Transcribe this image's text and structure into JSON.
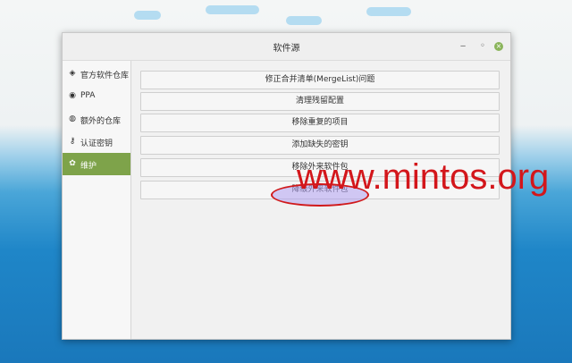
{
  "window": {
    "title": "软件源",
    "controls": {
      "minimize": "‒",
      "restore": "◦",
      "close": "×"
    }
  },
  "sidebar": {
    "items": [
      {
        "label": "官方软件仓库",
        "icon": "package-icon",
        "glyph": "◈"
      },
      {
        "label": "PPA",
        "icon": "ppa-icon",
        "glyph": "◉"
      },
      {
        "label": "额外的仓库",
        "icon": "repo-icon",
        "glyph": "◍"
      },
      {
        "label": "认证密钥",
        "icon": "key-icon",
        "glyph": "⚷"
      },
      {
        "label": "维护",
        "icon": "maintenance-icon",
        "glyph": "✿",
        "active": true
      }
    ]
  },
  "maintenance": {
    "buttons": [
      "修正合并清单(MergeList)问题",
      "清理残留配置",
      "移除重复的项目",
      "添加缺失的密钥",
      "移除外来软件包",
      "降级外来软件包"
    ]
  },
  "watermark": "www.mintos.org",
  "colors": {
    "accent": "#7ea34a",
    "highlight": "#d0191b"
  }
}
